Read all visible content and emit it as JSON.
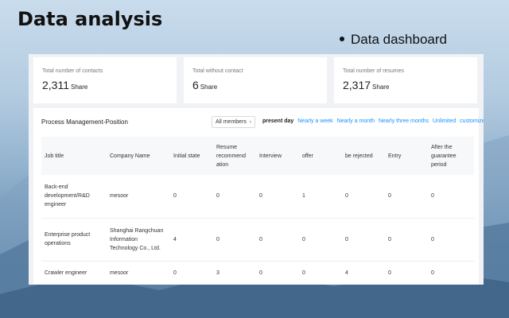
{
  "page": {
    "title": "Data analysis",
    "subtitle": "Data dashboard"
  },
  "stats": [
    {
      "label": "Total number of contacts",
      "value": "2,311",
      "unit": "Share"
    },
    {
      "label": "Total without contact",
      "value": "6",
      "unit": "Share"
    },
    {
      "label": "Total number of resumes",
      "value": "2,317",
      "unit": "Share"
    }
  ],
  "process": {
    "title": "Process Management-Position",
    "member_select": "All members",
    "filters": [
      "present day",
      "Nearly a week",
      "Nearly a month",
      "Nearly three months",
      "Unlimited",
      "customize"
    ],
    "active_filter": "present day",
    "columns": [
      "Job title",
      "Company Name",
      "Initial state",
      "Resume recommend ation",
      "Interview",
      "offer",
      "be rejected",
      "Entry",
      "After the guarantee period"
    ],
    "rows": [
      [
        "Back-end development/R&D engineer",
        "mesoor",
        "0",
        "0",
        "0",
        "1",
        "0",
        "0",
        "0"
      ],
      [
        "Enterprise product operations",
        "Shanghai Rangchuan Information Technology Co., Ltd.",
        "4",
        "0",
        "0",
        "0",
        "0",
        "0",
        "0"
      ],
      [
        "Crawler engineer",
        "mesoor",
        "0",
        "3",
        "0",
        "0",
        "4",
        "0",
        "0"
      ]
    ]
  }
}
